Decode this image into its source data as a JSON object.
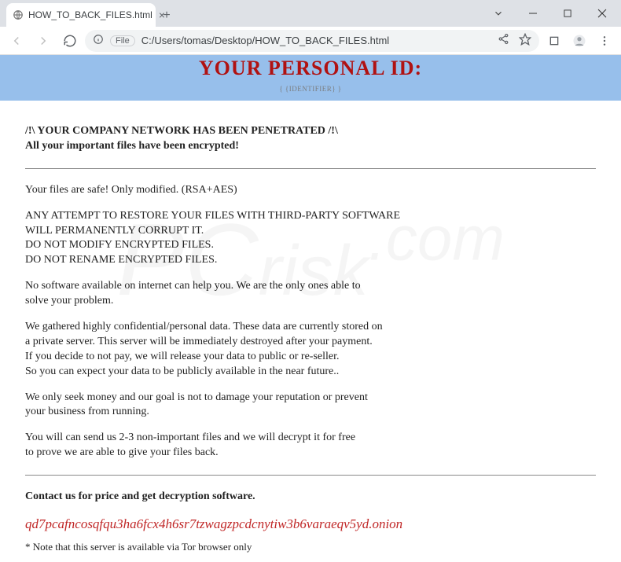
{
  "chrome": {
    "tab_title": "HOW_TO_BACK_FILES.html",
    "file_label": "File",
    "url": "C:/Users/tomas/Desktop/HOW_TO_BACK_FILES.html"
  },
  "banner": {
    "title": "YOUR PERSONAL ID:",
    "identifier": "{ {IDENTIFIER} }"
  },
  "body": {
    "alert1": "/!\\ YOUR COMPANY NETWORK HAS BEEN PENETRATED /!\\",
    "alert2": "All your important files have been encrypted!",
    "p1": "Your files are safe! Only modified. (RSA+AES)",
    "p2a": "ANY ATTEMPT TO RESTORE YOUR FILES WITH THIRD-PARTY SOFTWARE",
    "p2b": "WILL PERMANENTLY CORRUPT IT.",
    "p2c": "DO NOT MODIFY ENCRYPTED FILES.",
    "p2d": "DO NOT RENAME ENCRYPTED FILES.",
    "p3a": "No software available on internet can help you. We are the only ones able to",
    "p3b": "solve your problem.",
    "p4a": "We gathered highly confidential/personal data. These data are currently stored on",
    "p4b": "a private server. This server will be immediately destroyed after your payment.",
    "p4c": "If you decide to not pay, we will release your data to public or re-seller.",
    "p4d": "So you can expect your data to be publicly available in the near future..",
    "p5a": "We only seek money and our goal is not to damage your reputation or prevent",
    "p5b": "your business from running.",
    "p6a": "You will can send us 2-3 non-important files and we will decrypt it for free",
    "p6b": "to prove we are able to give your files back.",
    "contact": "Contact us for price and get decryption software.",
    "onion": "qd7pcafncosqfqu3ha6fcx4h6sr7tzwagzpcdcnytiw3b6varaeqv5yd.onion",
    "note": "* Note that this server is available via Tor browser only"
  }
}
